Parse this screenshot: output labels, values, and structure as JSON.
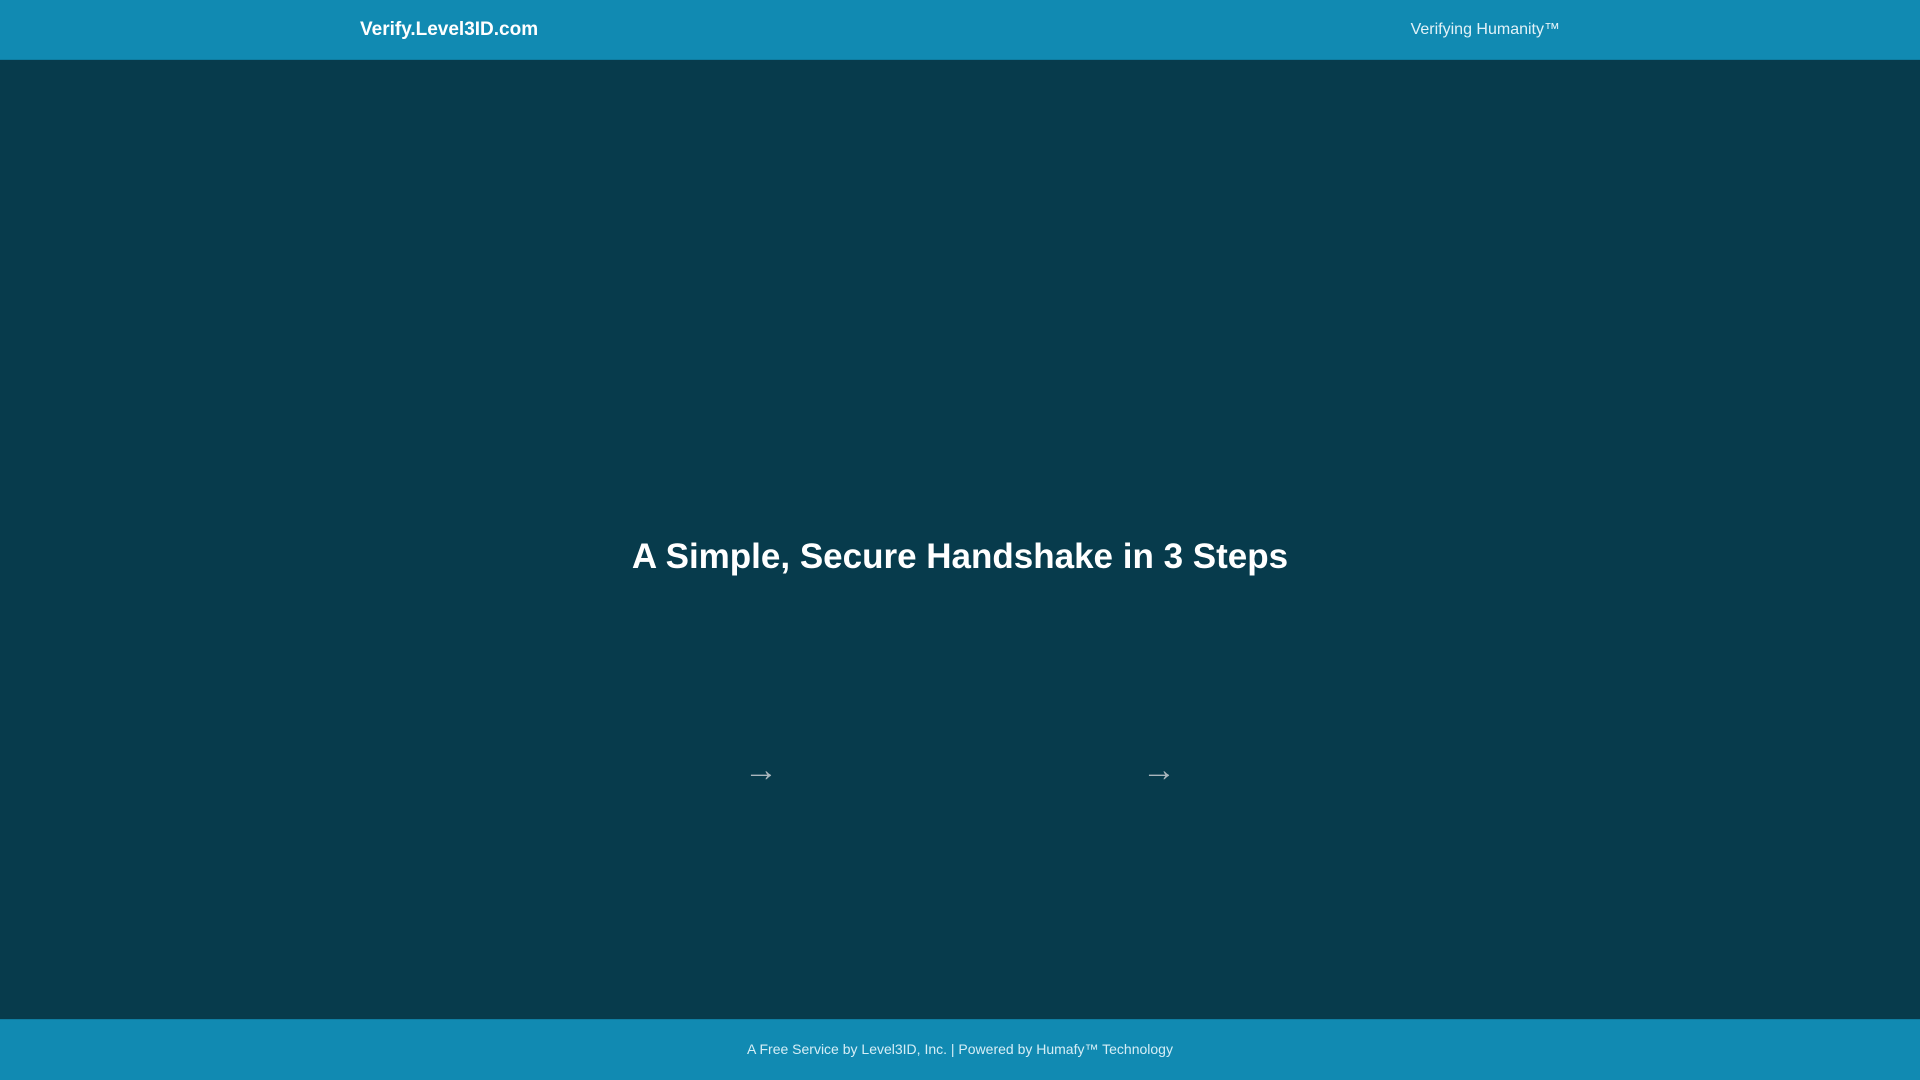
{
  "header": {
    "brand": "Verify.Level3ID.com",
    "tagline": "Verifying Humanity™"
  },
  "main": {
    "headline": "A Simple, Secure Handshake in 3 Steps",
    "steps_arrows": [
      "→",
      "→"
    ]
  },
  "footer": {
    "text": "A Free Service by Level3ID, Inc. | Powered by Humafy™ Technology"
  },
  "colors": {
    "header_bg": "#118ab2",
    "main_bg": "#073b4c",
    "headline": "#ffffff",
    "arrow": "#a9b6bd"
  },
  "icons": [
    "right-arrow-icon",
    "right-arrow-icon"
  ]
}
